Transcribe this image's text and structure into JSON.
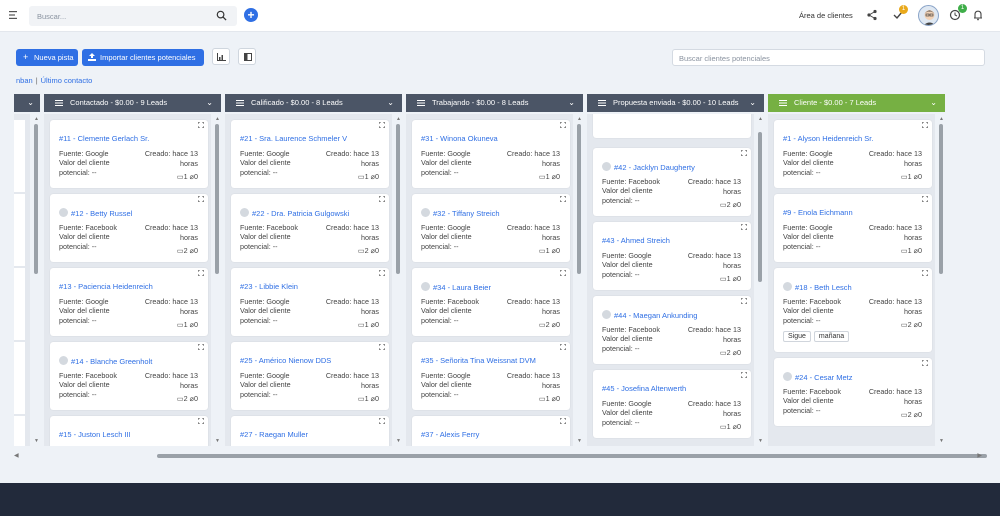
{
  "topbar": {
    "search_placeholder": "Buscar...",
    "area_label": "Área de clientes",
    "tasks_badge": "1",
    "timer_badge": "1"
  },
  "toolbar": {
    "new_lead_label": "Nueva pista",
    "import_label": "Importar clientes potenciales",
    "search_placeholder": "Buscar clientes potenciales"
  },
  "breadcrumb": {
    "first": "nban",
    "second": "Último contacto"
  },
  "colors": {
    "column_header": "#4b5566",
    "client_header": "#76b043",
    "accent": "#2f6fe4"
  },
  "labels": {
    "fuente": "Fuente:",
    "valor": "Valor del cliente",
    "potencial": "potencial: --",
    "creado": "Creado: hace 13",
    "horas": "horas"
  },
  "columns": [
    {
      "title": "Contactado - $0.00 - 9 Leads",
      "color": "#4b5566",
      "cards": [
        {
          "title": "#11 - Clemente Gerlach Sr.",
          "source": "Google",
          "avatar": false,
          "tasks": "1",
          "files": "0"
        },
        {
          "title": "#12 - Betty Russel",
          "source": "Facebook",
          "avatar": true,
          "tasks": "2",
          "files": "0"
        },
        {
          "title": "#13 - Paciencia Heidenreich",
          "source": "Google",
          "avatar": false,
          "tasks": "1",
          "files": "0"
        },
        {
          "title": "#14 - Blanche Greenholt",
          "source": "Facebook",
          "avatar": true,
          "tasks": "2",
          "files": "0"
        },
        {
          "title": "#15 - Juston Lesch III",
          "source": "",
          "avatar": false,
          "tasks": "",
          "files": ""
        }
      ]
    },
    {
      "title": "Calificado - $0.00 - 8 Leads",
      "color": "#4b5566",
      "cards": [
        {
          "title": "#21 - Sra. Laurence Schmeler V",
          "source": "Google",
          "avatar": false,
          "tasks": "1",
          "files": "0"
        },
        {
          "title": "#22 - Dra. Patricia Gulgowski",
          "source": "Facebook",
          "avatar": true,
          "tasks": "2",
          "files": "0"
        },
        {
          "title": "#23 - Libbie Klein",
          "source": "Google",
          "avatar": false,
          "tasks": "1",
          "files": "0"
        },
        {
          "title": "#25 - Américo Nienow DDS",
          "source": "Google",
          "avatar": false,
          "tasks": "1",
          "files": "0"
        },
        {
          "title": "#27 - Raegan Muller",
          "source": "",
          "avatar": false,
          "tasks": "",
          "files": ""
        }
      ]
    },
    {
      "title": "Trabajando - $0.00 - 8 Leads",
      "color": "#4b5566",
      "cards": [
        {
          "title": "#31 - Winona Okuneva",
          "source": "Google",
          "avatar": false,
          "tasks": "1",
          "files": "0"
        },
        {
          "title": "#32 - Tiffany Streich",
          "source": "Google",
          "avatar": true,
          "tasks": "1",
          "files": "0"
        },
        {
          "title": "#34 - Laura Beier",
          "source": "Facebook",
          "avatar": true,
          "tasks": "2",
          "files": "0"
        },
        {
          "title": "#35 - Señorita Tina Weissnat DVM",
          "source": "Google",
          "avatar": false,
          "tasks": "1",
          "files": "0"
        },
        {
          "title": "#37 - Alexis Ferry",
          "source": "",
          "avatar": false,
          "tasks": "",
          "files": ""
        }
      ]
    },
    {
      "title": "Propuesta enviada - $0.00 - 10 Leads",
      "color": "#4b5566",
      "cards": [
        {
          "title": "#42 - Jacklyn Daugherty",
          "source": "Facebook",
          "avatar": true,
          "tasks": "2",
          "files": "0"
        },
        {
          "title": "#43 - Ahmed Streich",
          "source": "Google",
          "avatar": false,
          "tasks": "1",
          "files": "0"
        },
        {
          "title": "#44 - Maegan Ankunding",
          "source": "Facebook",
          "avatar": true,
          "tasks": "2",
          "files": "0"
        },
        {
          "title": "#45 - Josefina Altenwerth",
          "source": "Google",
          "avatar": false,
          "tasks": "1",
          "files": "0"
        }
      ]
    },
    {
      "title": "Cliente - $0.00 - 7 Leads",
      "color": "#76b043",
      "cards": [
        {
          "title": "#1 - Alyson Heidenreich Sr.",
          "source": "Google",
          "avatar": false,
          "tasks": "1",
          "files": "0"
        },
        {
          "title": "#9 - Enola Eichmann",
          "source": "Google",
          "avatar": false,
          "tasks": "1",
          "files": "0"
        },
        {
          "title": "#18 - Beth Lesch",
          "source": "Facebook",
          "avatar": true,
          "tasks": "2",
          "files": "0",
          "tags": [
            "Sigue",
            "mañana"
          ]
        },
        {
          "title": "#24 - Cesar Metz",
          "source": "Facebook",
          "avatar": true,
          "tasks": "2",
          "files": "0"
        }
      ]
    }
  ],
  "partial_top_card": {
    "tasks": "1",
    "files": "0"
  }
}
